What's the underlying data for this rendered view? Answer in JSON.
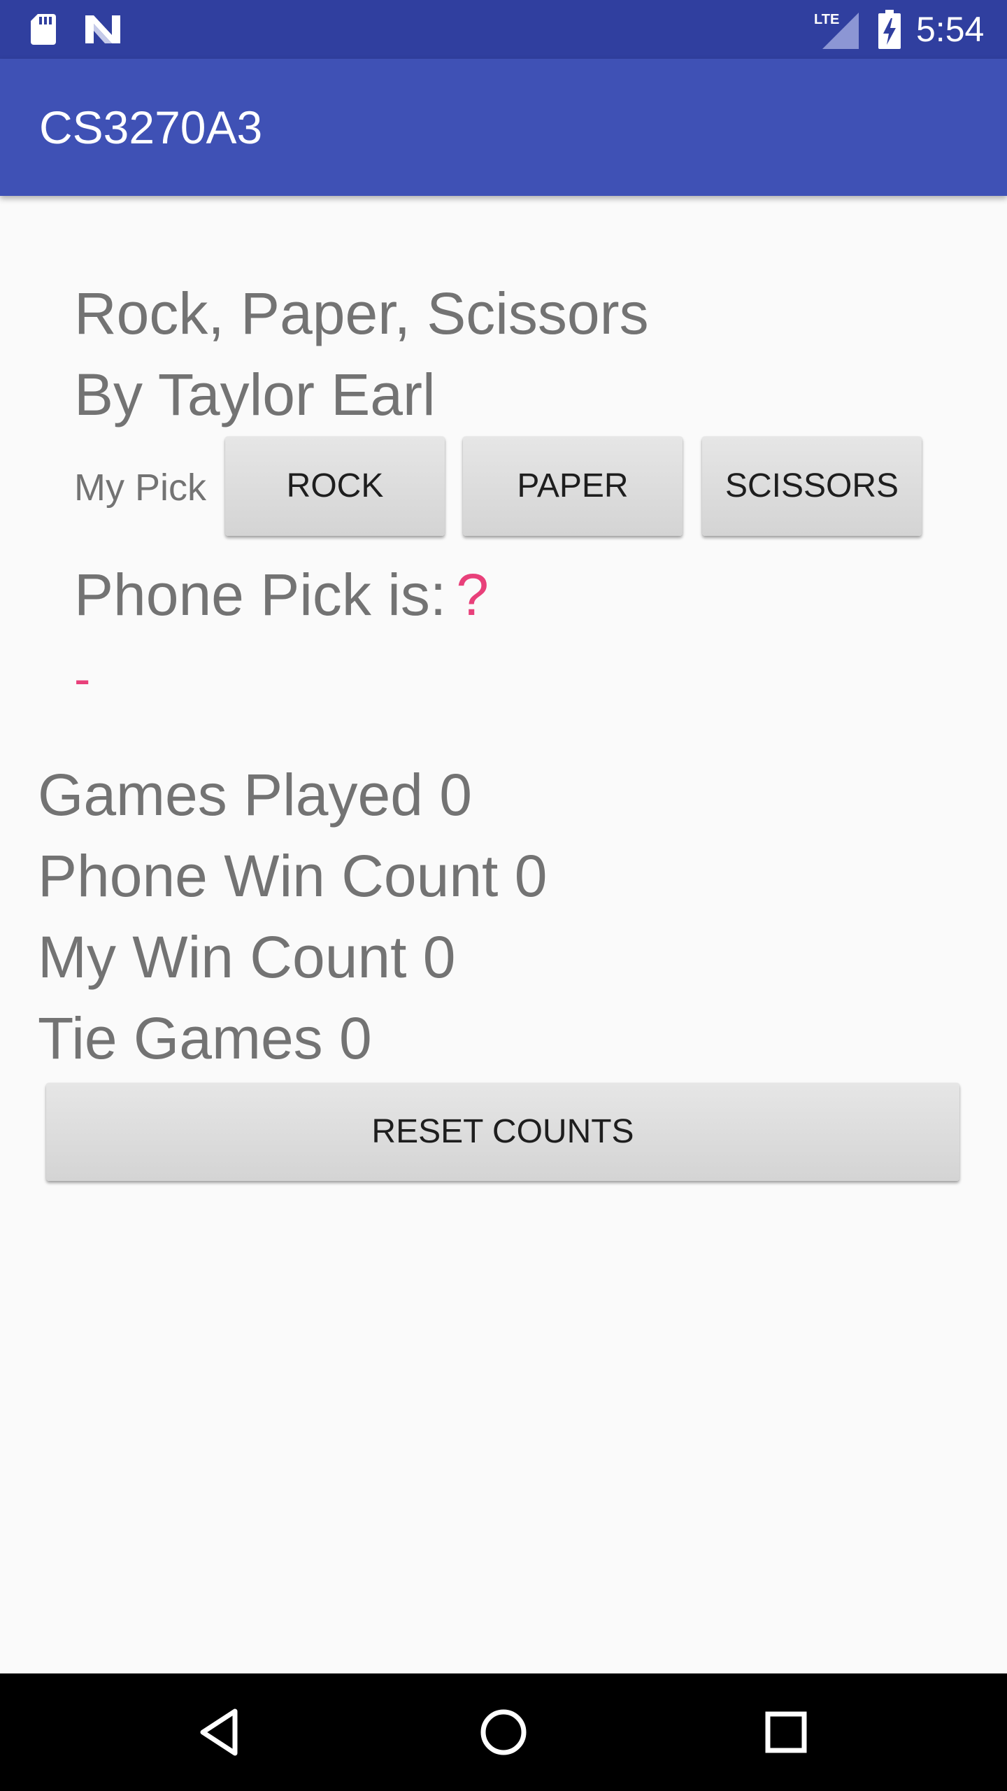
{
  "status_bar": {
    "time": "5:54",
    "network_label": "LTE",
    "icons": [
      "sd-card-icon",
      "n-notification-icon",
      "lte-signal-icon",
      "battery-charging-icon"
    ]
  },
  "app_bar": {
    "title": "CS3270A3"
  },
  "main": {
    "title": "Rock, Paper, Scissors",
    "author": "By Taylor Earl",
    "my_pick_label": "My Pick",
    "buttons": {
      "rock": "ROCK",
      "paper": "PAPER",
      "scissors": "SCISSORS"
    },
    "phone_pick_label": "Phone Pick is:",
    "phone_pick_value": "?",
    "result_text": "-",
    "stats": {
      "games_played": "Games Played 0",
      "phone_win_count": "Phone Win Count 0",
      "my_win_count": "My Win Count 0",
      "tie_games": "Tie Games 0"
    },
    "reset_button": "RESET COUNTS"
  },
  "nav_bar": {
    "icons": [
      "back-icon",
      "home-icon",
      "recents-icon"
    ]
  },
  "colors": {
    "status_bar": "#303f9f",
    "app_bar": "#3f51b5",
    "accent": "#e8407a",
    "text_secondary": "#737373",
    "background": "#fafafa"
  }
}
